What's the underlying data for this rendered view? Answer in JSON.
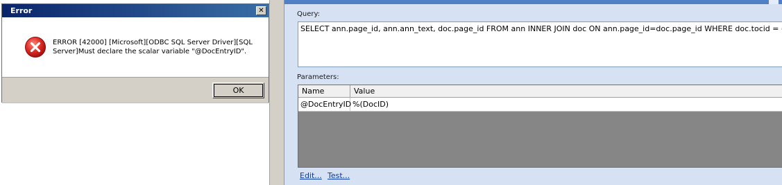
{
  "query_panel": {
    "query_label": "Query:",
    "query_text": "SELECT ann.page_id, ann.ann_text, doc.page_id FROM ann INNER JOIN doc ON ann.page_id=doc.page_id WHERE doc.tocid = @DocEntryID",
    "parameters_label": "Parameters:",
    "columns": [
      "Name",
      "Value"
    ],
    "rows": [
      {
        "name": "@DocEntryID",
        "value": "%(DocID)"
      }
    ],
    "edit_link": "Edit...",
    "test_link": "Test..."
  },
  "error_dialog": {
    "title": "Error",
    "close_glyph": "✕",
    "icon": "error-x-icon",
    "message": "ERROR [42000] [Microsoft][ODBC SQL Server Driver][SQL Server]Must declare the scalar variable \"@DocEntryID\".",
    "ok_label": "OK"
  },
  "colors": {
    "dialog_title_bar": "#0a246a",
    "panel_background": "#d6e2f3",
    "error_icon": "#d22020",
    "link": "#0b3aa6"
  }
}
